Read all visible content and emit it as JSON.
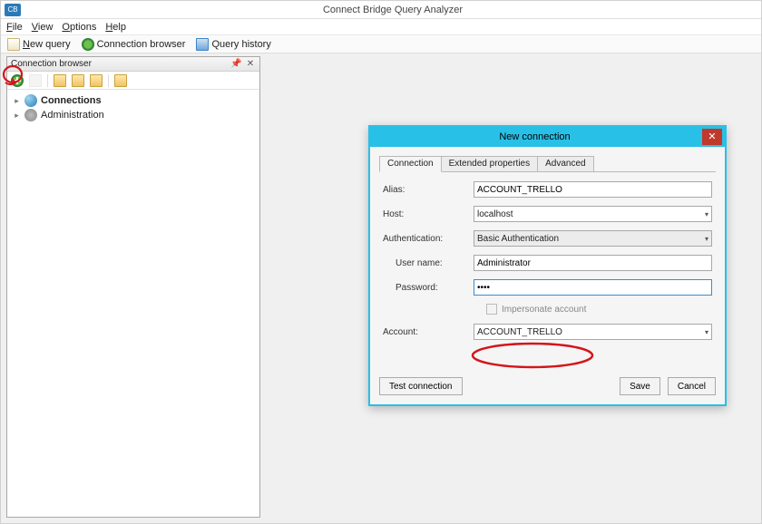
{
  "window": {
    "title": "Connect Bridge Query Analyzer",
    "app_icon_text": "CB"
  },
  "menus": {
    "file": "File",
    "view": "View",
    "options": "Options",
    "help": "Help"
  },
  "toolbar": {
    "new_query": "New query",
    "connection_browser": "Connection browser",
    "query_history": "Query history"
  },
  "panel": {
    "title": "Connection browser",
    "pinned": true,
    "tree": {
      "connections_label": "Connections",
      "administration_label": "Administration"
    }
  },
  "dialog": {
    "title": "New connection",
    "tabs": {
      "connection": "Connection",
      "extended": "Extended properties",
      "advanced": "Advanced",
      "active": "connection"
    },
    "labels": {
      "alias": "Alias:",
      "host": "Host:",
      "authentication": "Authentication:",
      "username": "User name:",
      "password": "Password:",
      "impersonate": "Impersonate account",
      "account": "Account:"
    },
    "values": {
      "alias": "ACCOUNT_TRELLO",
      "host": "localhost",
      "authentication": "Basic Authentication",
      "username": "Administrator",
      "password": "••••",
      "impersonate_checked": false,
      "account": "ACCOUNT_TRELLO"
    },
    "buttons": {
      "test": "Test connection",
      "save": "Save",
      "cancel": "Cancel"
    }
  },
  "annotations": {
    "circle_add_connection": true,
    "circle_account_field": true
  }
}
